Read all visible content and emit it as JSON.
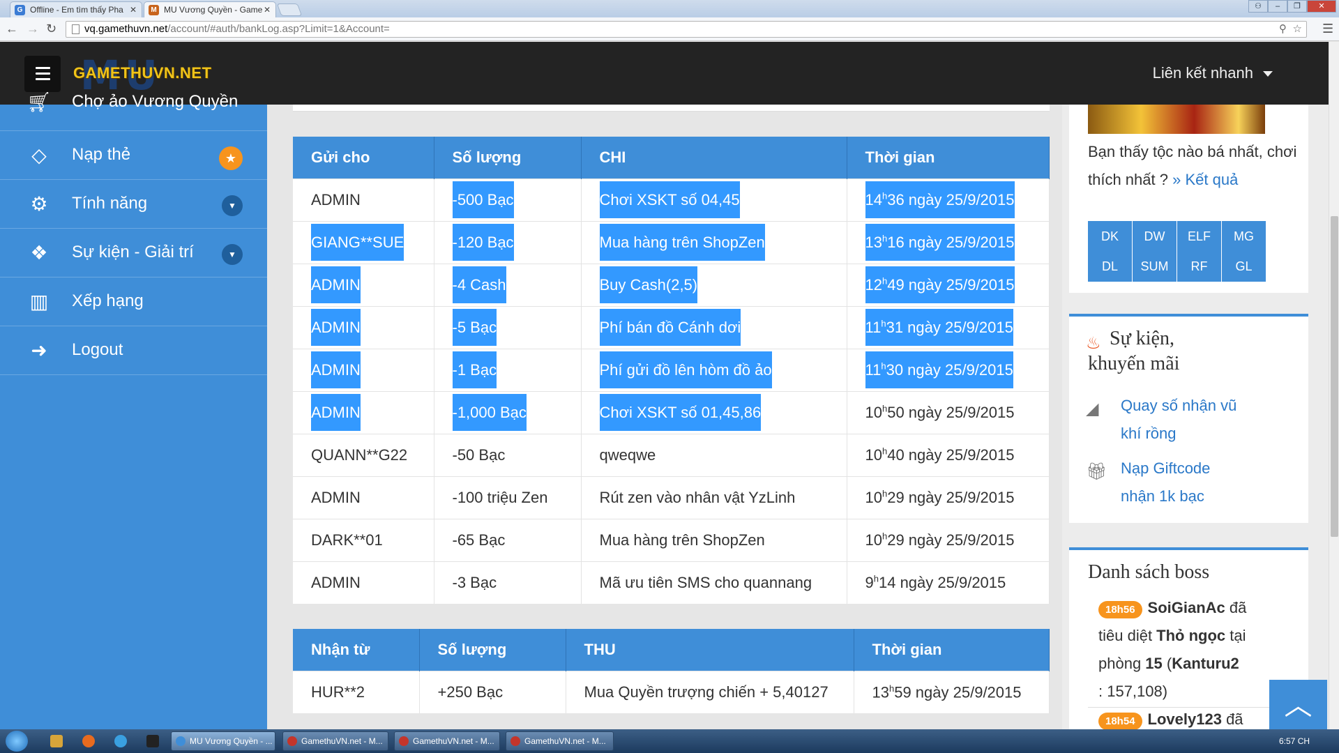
{
  "browser": {
    "tabs": [
      {
        "label": "Offline - Em tìm thấy Pha",
        "icon": "G"
      },
      {
        "label": "MU Vương Quyền - Game",
        "icon": "M"
      }
    ],
    "url_host": "vq.gamethuvn.net",
    "url_rest": "/account/#auth/bankLog.asp?Limit=1&Account="
  },
  "header": {
    "logo_text": "GAMETHUVN.NET",
    "logo_bg": "MU",
    "quick_link": "Liên kết nhanh"
  },
  "sidebar": {
    "items": [
      {
        "label": "Chợ ảo Vương Quyền",
        "icon": "cart"
      },
      {
        "label": "Nạp thẻ",
        "icon": "diamond"
      },
      {
        "label": "Tính năng",
        "icon": "gears"
      },
      {
        "label": "Sự kiện - Giải trí",
        "icon": "event"
      },
      {
        "label": "Xếp hạng",
        "icon": "chart"
      },
      {
        "label": "Logout",
        "icon": "logout"
      }
    ]
  },
  "spend_table": {
    "headers": [
      "Gửi cho",
      "Số lượng",
      "CHI",
      "Thời gian"
    ],
    "rows": [
      {
        "to": "ADMIN",
        "qty": "-500  Bạc",
        "desc": "Chơi XSKT số 04,45",
        "h": "14",
        "time": "36 ngày 25/9/2015"
      },
      {
        "to": "GIANG**SUE",
        "qty": "-120  Bạc",
        "desc": "Mua hàng trên ShopZen",
        "h": "13",
        "time": "16 ngày 25/9/2015"
      },
      {
        "to": "ADMIN",
        "qty": "-4  Cash",
        "desc": "Buy Cash(2,5)",
        "h": "12",
        "time": "49 ngày 25/9/2015"
      },
      {
        "to": "ADMIN",
        "qty": "-5  Bạc",
        "desc": "Phí bán đồ Cánh dơi",
        "h": "11",
        "time": "31 ngày 25/9/2015"
      },
      {
        "to": "ADMIN",
        "qty": "-1  Bạc",
        "desc": "Phí gửi đồ lên hòm đồ ảo",
        "h": "11",
        "time": "30 ngày 25/9/2015"
      },
      {
        "to": "ADMIN",
        "qty": "-1,000  Bạc",
        "desc": "Chơi XSKT số 01,45,86",
        "h": "10",
        "time": "50 ngày 25/9/2015"
      },
      {
        "to": "QUANN**G22",
        "qty": "-50  Bạc",
        "desc": "qweqwe",
        "h": "10",
        "time": "40 ngày 25/9/2015"
      },
      {
        "to": "ADMIN",
        "qty": "-100  triệu Zen",
        "desc": "Rút zen vào nhân vật YzLinh",
        "h": "10",
        "time": "29 ngày 25/9/2015"
      },
      {
        "to": "DARK**01",
        "qty": "-65  Bạc",
        "desc": "Mua hàng trên ShopZen",
        "h": "10",
        "time": "29 ngày 25/9/2015"
      },
      {
        "to": "ADMIN",
        "qty": "-3  Bạc",
        "desc": "Mã ưu tiên SMS cho quannang",
        "h": "9",
        "time": "14 ngày 25/9/2015"
      }
    ]
  },
  "receive_table": {
    "headers": [
      "Nhận từ",
      "Số lượng",
      "THU",
      "Thời gian"
    ],
    "rows": [
      {
        "from": "HUR**2",
        "qty": "+250  Bạc",
        "desc": "Mua Quyền trượng chiến + 5,40127",
        "h": "13",
        "time": "59 ngày 25/9/2015"
      }
    ]
  },
  "poll": {
    "question": "Bạn thấy tộc nào bá nhất, chơi thích nhất ?",
    "result_link": "Kết quả",
    "classes_row1": [
      "DK",
      "DW",
      "ELF",
      "MG"
    ],
    "classes_row2": [
      "DL",
      "SUM",
      "RF",
      "GL"
    ]
  },
  "events": {
    "title_line1": "Sự kiện,",
    "title_line2": "khuyến mãi",
    "items": [
      {
        "line1": "Quay số nhận vũ",
        "line2": "khí rồng"
      },
      {
        "line1": "Nạp Giftcode",
        "line2": "nhận 1k bạc"
      }
    ]
  },
  "boss": {
    "title": "Danh sách boss",
    "entries": [
      {
        "time": "18h56",
        "name": "SoiGianAc",
        "after": " đã",
        "line2a": "tiêu diệt ",
        "monster": "Thỏ ngọc",
        "line2b": " tại",
        "line3a": "phòng ",
        "room": "15",
        "line3b": " (",
        "map": "Kanturu2",
        "line4": ": 157,108)"
      },
      {
        "time": "18h54",
        "name": "Lovely123",
        "after": " đã"
      }
    ]
  },
  "taskbar": {
    "tasks": [
      "MU Vương Quyền - ...",
      "GamethuVN.net - M...",
      "GamethuVN.net - M...",
      "GamethuVN.net - M..."
    ],
    "clock": "6:57 CH"
  },
  "colors": {
    "sidebar": "#3f8ed8",
    "header": "#232323",
    "selection": "#3399ff",
    "badge": "#f7941d"
  }
}
